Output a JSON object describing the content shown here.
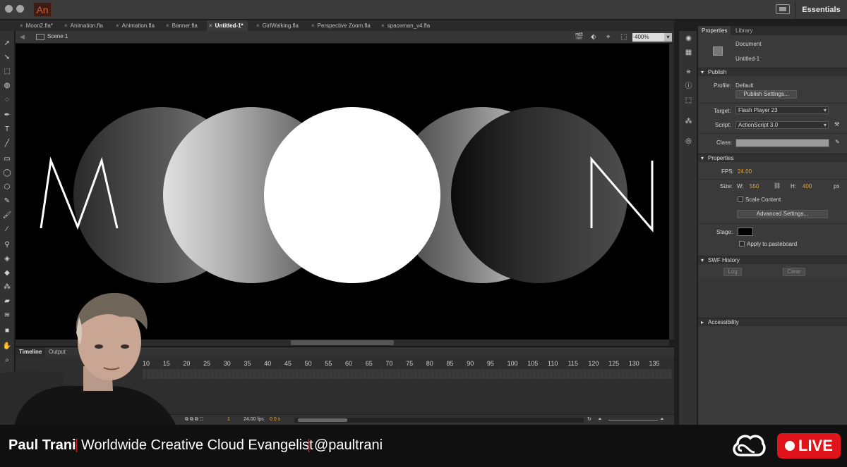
{
  "app": {
    "logo_text": "An"
  },
  "workspace": {
    "label": "Essentials"
  },
  "document_tabs": [
    {
      "label": "Moon2.fla*",
      "active": false
    },
    {
      "label": "Animation.fla",
      "active": false
    },
    {
      "label": "Animation.fla",
      "active": false
    },
    {
      "label": "Banner.fla",
      "active": false
    },
    {
      "label": "Untitled-1*",
      "active": true
    },
    {
      "label": "GirlWalking.fla",
      "active": false
    },
    {
      "label": "Perspective Zoom.fla",
      "active": false
    },
    {
      "label": "spaceman_v4.fla",
      "active": false
    }
  ],
  "tab_close_glyph": "×",
  "scene": {
    "label": "Scene 1",
    "zoom": "400%"
  },
  "stage": {
    "letter_left": "M",
    "letter_right": "N",
    "background": "#000000"
  },
  "timeline": {
    "tabs": [
      "Timeline",
      "Output"
    ],
    "ruler": [
      "10",
      "15",
      "20",
      "25",
      "30",
      "35",
      "40",
      "45",
      "50",
      "55",
      "60",
      "65",
      "70",
      "75",
      "80",
      "85",
      "90",
      "95",
      "100",
      "105",
      "110",
      "115",
      "120",
      "125",
      "130",
      "135"
    ],
    "current_frame": "1",
    "fps_readout": "24.00 fps",
    "time_readout": "0.0 s"
  },
  "panel": {
    "tabs": [
      "Properties",
      "Library"
    ],
    "doc_type": "Document",
    "doc_name": "Untitled-1",
    "publish": {
      "header": "Publish",
      "profile_label": "Profile:",
      "profile_value": "Default",
      "settings_button": "Publish Settings...",
      "target_label": "Target:",
      "target_value": "Flash Player 23",
      "script_label": "Script:",
      "script_value": "ActionScript 3.0",
      "class_label": "Class:"
    },
    "properties": {
      "header": "Properties",
      "fps_label": "FPS:",
      "fps_value": "24.00",
      "size_label": "Size:",
      "w_label": "W:",
      "w_value": "550",
      "h_label": "H:",
      "h_value": "400",
      "unit": "px",
      "scale_content": "Scale Content",
      "advanced_button": "Advanced Settings...",
      "stage_label": "Stage:",
      "stage_color": "#000000",
      "pasteboard": "Apply to pasteboard"
    },
    "swf_history": {
      "header": "SWF History",
      "log_button": "Log",
      "clear_button": "Clear"
    },
    "accessibility": {
      "header": "Accessibility"
    }
  },
  "lower_third": {
    "name": "Paul Trani",
    "separator": "|",
    "role": "Worldwide Creative Cloud Evangelist",
    "handle": "@paultrani",
    "live_label": "LIVE",
    "accent_color": "#e0141a"
  }
}
